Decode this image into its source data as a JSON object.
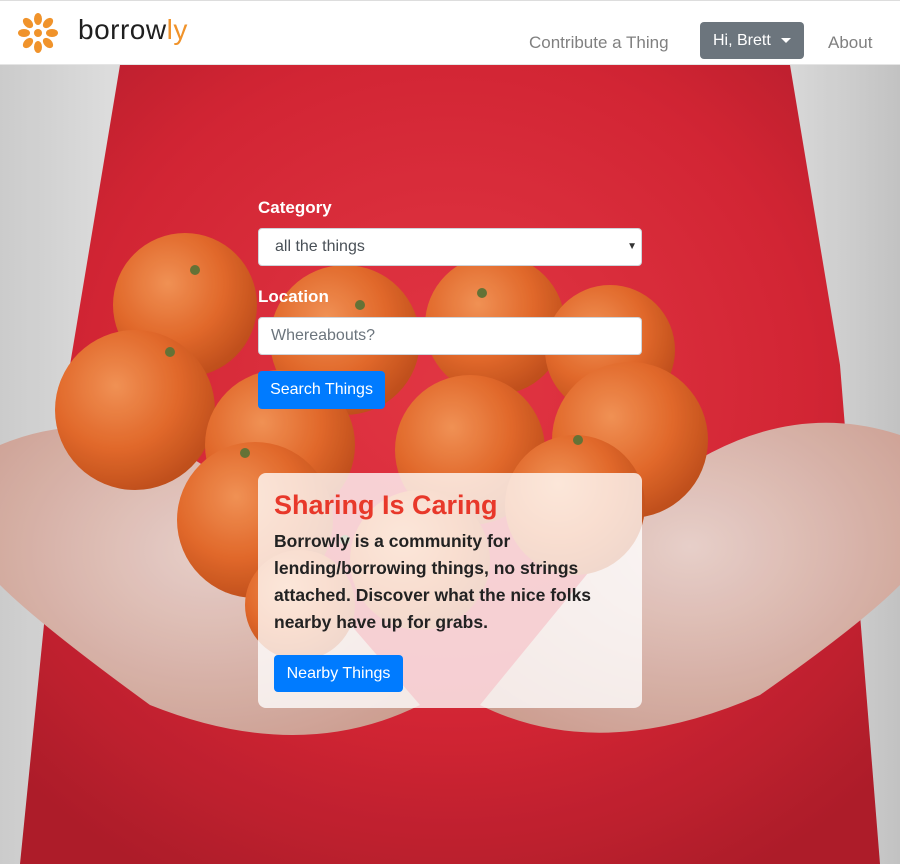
{
  "brand": {
    "name_part1": "borrow",
    "name_part2": "ly",
    "logo_icon": "flower-logo-icon"
  },
  "nav": {
    "contribute_label": "Contribute a Thing",
    "user_label": "Hi, Brett",
    "about_label": "About"
  },
  "search": {
    "category_label": "Category",
    "category_selected": "all the things",
    "location_label": "Location",
    "location_placeholder": "Whereabouts?",
    "search_button": "Search Things"
  },
  "card": {
    "title": "Sharing Is Caring",
    "text": "Borrowly is a community for lending/borrowing things, no strings attached. Discover what the nice folks nearby have up for grabs.",
    "button": "Nearby Things"
  },
  "colors": {
    "brand_orange": "#f0932b",
    "primary": "#007bff",
    "title_red": "#e8382a",
    "secondary": "#6c757d"
  }
}
